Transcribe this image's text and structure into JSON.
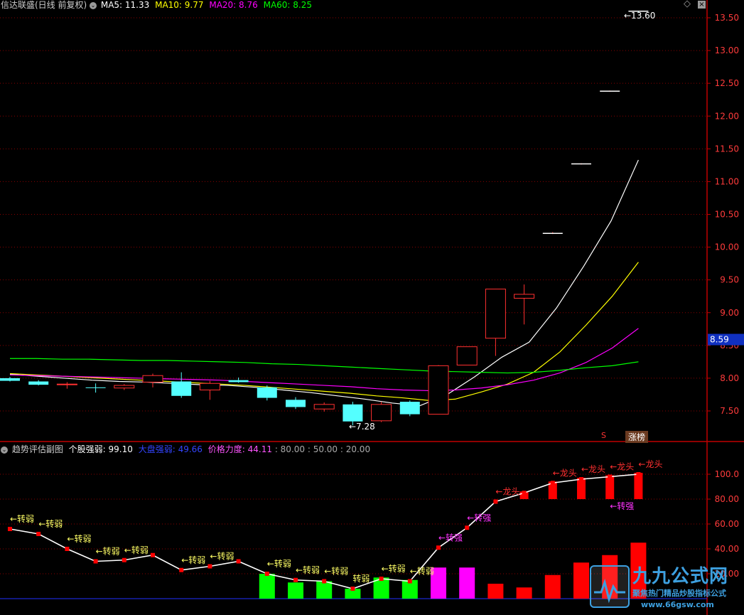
{
  "main_header": {
    "title": "信达联盛(日线 前复权)",
    "ma5_label": "MA5: 11.33",
    "ma10_label": "MA10: 9.77",
    "ma20_label": "MA20: 8.76",
    "ma60_label": "MA60: 8.25",
    "diamond_icon": "diamond-icon",
    "colors": {
      "ma5": "#ffffff",
      "ma10": "#ffff00",
      "ma20": "#ff00ff",
      "ma60": "#00ff00"
    }
  },
  "sub_header": {
    "title": "趋势评估副图",
    "stock_strength": "个股强弱: 99.10",
    "market_strength": "大盘强弱: 49.66",
    "price_force": "价格力度: 44.11",
    "levels": ": 80.00 : 50.00 : 20.00"
  },
  "price_axis": {
    "ticks": [
      "13.50",
      "13.00",
      "12.50",
      "12.00",
      "11.50",
      "11.00",
      "10.50",
      "10.00",
      "9.50",
      "9.00",
      "8.50",
      "8.00",
      "7.50"
    ],
    "current_price": "8.59",
    "high_label": "13.60",
    "low_label": "7.28"
  },
  "ind_axis": {
    "ticks": [
      "100.0",
      "80.00",
      "60.00",
      "40.00",
      "20.00"
    ]
  },
  "badges": {
    "zhangbang": "涨榜",
    "s_marker": "S"
  },
  "watermark": {
    "brand": "九九公式网",
    "caption": "聚焦热门精品炒股指标公式",
    "url": "www.66gsw.com"
  },
  "chart_data": [
    {
      "type": "candlestick",
      "title": "信达联盛(日线 前复权)",
      "ylim": [
        7.0,
        13.8
      ],
      "candles": [
        {
          "o": 8.0,
          "h": 8.02,
          "l": 7.95,
          "c": 7.96
        },
        {
          "o": 7.95,
          "h": 7.97,
          "l": 7.89,
          "c": 7.9
        },
        {
          "o": 7.9,
          "h": 7.94,
          "l": 7.84,
          "c": 7.91
        },
        {
          "o": 7.86,
          "h": 7.92,
          "l": 7.78,
          "c": 7.85
        },
        {
          "o": 7.85,
          "h": 7.91,
          "l": 7.82,
          "c": 7.89
        },
        {
          "o": 7.94,
          "h": 8.07,
          "l": 7.86,
          "c": 8.04
        },
        {
          "o": 7.95,
          "h": 8.09,
          "l": 7.7,
          "c": 7.73
        },
        {
          "o": 7.82,
          "h": 7.96,
          "l": 7.67,
          "c": 7.92
        },
        {
          "o": 7.97,
          "h": 8.01,
          "l": 7.93,
          "c": 7.94
        },
        {
          "o": 7.86,
          "h": 7.89,
          "l": 7.66,
          "c": 7.7
        },
        {
          "o": 7.67,
          "h": 7.71,
          "l": 7.53,
          "c": 7.56
        },
        {
          "o": 7.53,
          "h": 7.63,
          "l": 7.49,
          "c": 7.6
        },
        {
          "o": 7.6,
          "h": 7.64,
          "l": 7.28,
          "c": 7.34
        },
        {
          "o": 7.35,
          "h": 7.64,
          "l": 7.33,
          "c": 7.6
        },
        {
          "o": 7.64,
          "h": 7.66,
          "l": 7.42,
          "c": 7.45
        },
        {
          "o": 7.45,
          "h": 8.2,
          "l": 7.45,
          "c": 8.19
        },
        {
          "o": 8.2,
          "h": 8.48,
          "l": 8.2,
          "c": 8.48
        },
        {
          "o": 8.61,
          "h": 8.95,
          "l": 8.34,
          "c": 9.36
        },
        {
          "o": 9.22,
          "h": 9.43,
          "l": 8.82,
          "c": 9.28
        },
        {
          "o": 10.2,
          "h": 10.23,
          "l": 10.2,
          "c": 10.21
        },
        {
          "o": 11.26,
          "h": 11.28,
          "l": 11.26,
          "c": 11.27
        },
        {
          "o": 12.37,
          "h": 12.39,
          "l": 12.37,
          "c": 12.38
        },
        {
          "o": 13.6,
          "h": 13.6,
          "l": 13.58,
          "c": 13.59
        }
      ],
      "series": [
        {
          "name": "MA5",
          "values": [
            8.06,
            8.03,
            8.0,
            7.97,
            7.95,
            7.94,
            7.92,
            7.9,
            7.89,
            7.86,
            7.82,
            7.78,
            7.73,
            7.68,
            7.62,
            7.58,
            7.75,
            8.02,
            8.32,
            8.55,
            9.07,
            9.71,
            10.4,
            11.33
          ]
        },
        {
          "name": "MA10",
          "values": [
            8.07,
            8.05,
            8.03,
            8.01,
            7.99,
            7.97,
            7.95,
            7.93,
            7.91,
            7.89,
            7.86,
            7.83,
            7.8,
            7.77,
            7.73,
            7.7,
            7.66,
            7.68,
            7.79,
            7.91,
            8.09,
            8.4,
            8.81,
            9.25,
            9.77
          ]
        },
        {
          "name": "MA20",
          "values": [
            8.05,
            8.04,
            8.03,
            8.02,
            8.01,
            8.0,
            7.99,
            7.98,
            7.97,
            7.95,
            7.93,
            7.91,
            7.89,
            7.87,
            7.84,
            7.82,
            7.81,
            7.82,
            7.85,
            7.9,
            7.97,
            8.08,
            8.24,
            8.46,
            8.76
          ]
        },
        {
          "name": "MA60",
          "values": [
            8.3,
            8.3,
            8.29,
            8.29,
            8.28,
            8.27,
            8.27,
            8.26,
            8.25,
            8.24,
            8.22,
            8.21,
            8.19,
            8.17,
            8.15,
            8.13,
            8.11,
            8.1,
            8.09,
            8.08,
            8.09,
            8.12,
            8.16,
            8.19,
            8.25
          ]
        }
      ]
    },
    {
      "type": "bar",
      "title": "趋势评估副图",
      "ylim": [
        0,
        120
      ],
      "strength_line": [
        56,
        52,
        40,
        30,
        31,
        35,
        23,
        26,
        30,
        20,
        15,
        14,
        8,
        16,
        14,
        41,
        57,
        78,
        85,
        93,
        96,
        98,
        100
      ],
      "bars": [
        0,
        0,
        0,
        0,
        0,
        0,
        0,
        0,
        0,
        20,
        13,
        14,
        8,
        17,
        15,
        25,
        25,
        12,
        9,
        19,
        29,
        35,
        45
      ],
      "bar_colors": [
        "",
        "",
        "",
        "",
        "",
        "",
        "",
        "",
        "",
        "#00ff00",
        "#00ff00",
        "#00ff00",
        "#00ff00",
        "#00ff00",
        "#00ff00",
        "#ff00ff",
        "#ff00ff",
        "#ff0000",
        "#ff0000",
        "#ff0000",
        "#ff0000",
        "#ff0000",
        "#ff0000"
      ],
      "signals": [
        {
          "i": 0,
          "v": 56,
          "text": "←转弱"
        },
        {
          "i": 1,
          "v": 52,
          "text": "←转弱"
        },
        {
          "i": 2,
          "v": 40,
          "text": "←转弱"
        },
        {
          "i": 3,
          "v": 30,
          "text": "←转弱"
        },
        {
          "i": 4,
          "v": 31,
          "text": "←转弱"
        },
        {
          "i": 6,
          "v": 23,
          "text": "←转弱"
        },
        {
          "i": 7,
          "v": 26,
          "text": "←转弱"
        },
        {
          "i": 9,
          "v": 20,
          "text": "←转弱"
        },
        {
          "i": 10,
          "v": 15,
          "text": "←转弱"
        },
        {
          "i": 11,
          "v": 14,
          "text": "←转弱"
        },
        {
          "i": 12,
          "v": 8,
          "text": "转弱"
        },
        {
          "i": 13,
          "v": 16,
          "text": "←转弱"
        },
        {
          "i": 14,
          "v": 14,
          "text": "←转弱"
        },
        {
          "i": 15,
          "v": 41,
          "text": "←转强"
        },
        {
          "i": 16,
          "v": 57,
          "text": "←转强"
        },
        {
          "i": 17,
          "v": 78,
          "text": "←龙头"
        },
        {
          "i": 19,
          "v": 93,
          "text": "←龙头"
        },
        {
          "i": 20,
          "v": 96,
          "text": "←龙头"
        },
        {
          "i": 21,
          "v": 98,
          "text": "←龙头"
        },
        {
          "i": 22,
          "v": 100,
          "text": "←龙头"
        },
        {
          "i": 21,
          "v": 80,
          "text": "←转强"
        }
      ]
    }
  ]
}
